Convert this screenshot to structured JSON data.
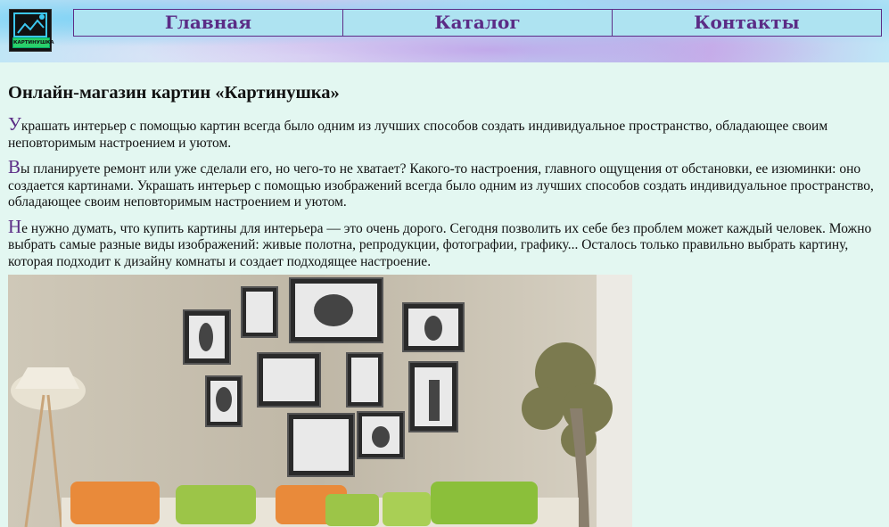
{
  "logo": {
    "label": "КАРТИНУШКА"
  },
  "nav": {
    "items": [
      {
        "label": "Главная"
      },
      {
        "label": "Каталог"
      },
      {
        "label": "Контакты"
      }
    ]
  },
  "main": {
    "title": "Онлайн-магазин картин «Картинушка»",
    "paragraphs": [
      {
        "first": "У",
        "rest": "крашать интерьер с помощью картин всегда было одним из лучших способов создать индивидуальное пространство, обладающее своим неповторимым настроением и уютом."
      },
      {
        "first": "В",
        "rest": "ы планируете ремонт или уже сделали его, но чего-то не хватает? Какого-то настроения, главного ощущения от обстановки, ее изюминки: оно создается картинами. Украшать интерьер с помощью изображений всегда было одним из лучших способов создать индивидуальное пространство, обладающее своим неповторимым настроением и уютом."
      },
      {
        "first": "Н",
        "rest": "е нужно думать, что купить картины для интерьера — это очень дорого. Сегодня позволить их себе без проблем может каждый человек. Можно выбрать самые разные виды изображений: живые полотна, репродукции, фотографии, графику... Осталось только правильно выбрать картину, которая подходит к дизайну комнаты и создает подходящее настроение."
      }
    ]
  },
  "colors": {
    "accent": "#5b2c86",
    "nav_bg": "#aee3f1",
    "page_bg": "#e3f7f1",
    "logo_green": "#2bd06a"
  }
}
